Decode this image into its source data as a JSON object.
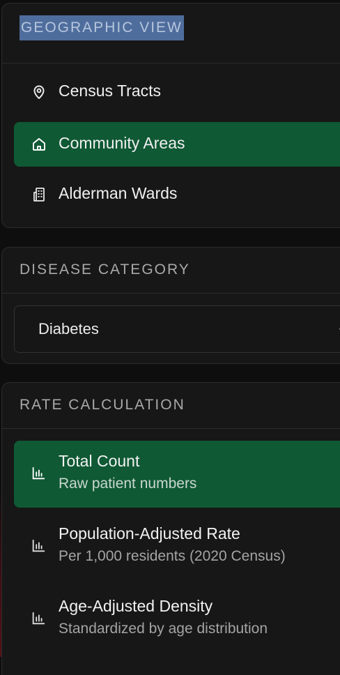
{
  "geographic_view": {
    "title": "GEOGRAPHIC VIEW",
    "items": [
      {
        "label": "Census Tracts",
        "icon": "map-pin-icon",
        "active": false
      },
      {
        "label": "Community Areas",
        "icon": "home-icon",
        "active": true
      },
      {
        "label": "Alderman Wards",
        "icon": "building-icon",
        "active": false
      }
    ]
  },
  "disease_category": {
    "title": "DISEASE CATEGORY",
    "selected": "Diabetes"
  },
  "rate_calculation": {
    "title": "RATE CALCULATION",
    "items": [
      {
        "label": "Total Count",
        "sublabel": "Raw patient numbers",
        "icon": "bar-chart-icon",
        "active": true
      },
      {
        "label": "Population-Adjusted Rate",
        "sublabel": "Per 1,000 residents (2020 Census)",
        "icon": "bar-chart-icon",
        "active": false
      },
      {
        "label": "Age-Adjusted Density",
        "sublabel": "Standardized by age distribution",
        "icon": "bar-chart-icon",
        "active": false
      }
    ]
  },
  "colors": {
    "background": "#0e0e0e",
    "panel": "#171717",
    "active_green": "#0f5934",
    "selection_highlight": "#4f6d9c"
  }
}
